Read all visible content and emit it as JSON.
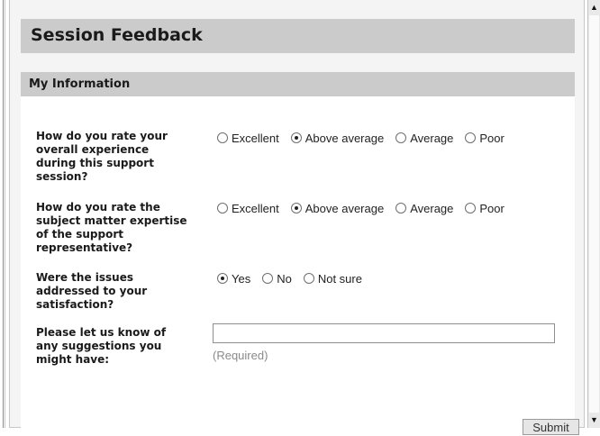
{
  "page": {
    "title": "Session Feedback",
    "section_title": "My Information"
  },
  "questions": [
    {
      "text": "How do you rate your overall experience during this support session?",
      "options": [
        "Excellent",
        "Above average",
        "Average",
        "Poor"
      ],
      "selected": "Above average"
    },
    {
      "text": "How do you rate the subject matter expertise of the support representative?",
      "options": [
        "Excellent",
        "Above average",
        "Average",
        "Poor"
      ],
      "selected": "Above average"
    },
    {
      "text": "Were the issues addressed to your satisfaction?",
      "options": [
        "Yes",
        "No",
        "Not sure"
      ],
      "selected": "Yes"
    }
  ],
  "suggestions": {
    "label": "Please let us know of any suggestions you might have:",
    "value": "",
    "hint": "(Required)"
  },
  "submit_label": "Submit",
  "scrollbar": {
    "up_icon": "arrow-up-icon",
    "down_icon": "arrow-down-icon"
  }
}
